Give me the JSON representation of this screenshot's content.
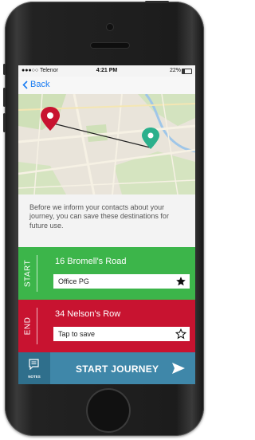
{
  "status_bar": {
    "carrier": "●●●○○ Telenor",
    "time": "4:21 PM",
    "battery": "22%"
  },
  "nav": {
    "back_label": "Back",
    "back_icon": "chevron-left-icon"
  },
  "map": {
    "start_pin_color": "#c81330",
    "end_pin_color": "#2bb08c"
  },
  "info": {
    "message": "Before we inform your contacts about your journey, you can save these destinations for future use."
  },
  "start": {
    "label": "START",
    "address": "16 Bromell's Road",
    "saved_name": "Office PG",
    "saved": true,
    "color": "#3cb54a"
  },
  "end": {
    "label": "END",
    "address": "34 Nelson's Row",
    "saved_name": "Tap to save",
    "saved": false,
    "color": "#c81330"
  },
  "bottom_bar": {
    "notes_label": "NOTES",
    "start_label": "START JOURNEY",
    "color": "#3f87a9"
  }
}
